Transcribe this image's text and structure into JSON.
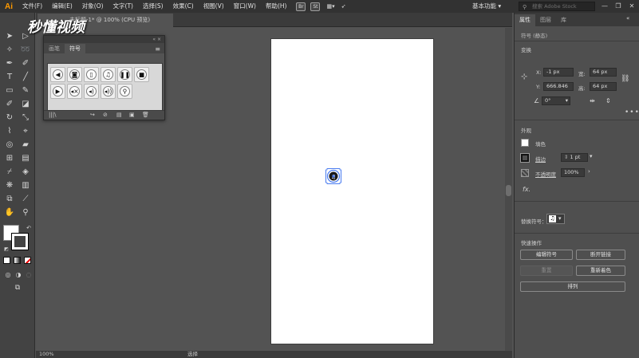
{
  "app": {
    "logo": "Ai"
  },
  "menu": [
    "文件(F)",
    "编辑(E)",
    "对象(O)",
    "文字(T)",
    "选择(S)",
    "效果(C)",
    "视图(V)",
    "窗口(W)",
    "帮助(H)"
  ],
  "menubar": {
    "bridge_label": "Br",
    "stock_label": "St",
    "workspace_label": "基本功能",
    "search_placeholder": "搜索 Adobe Stock",
    "window_buttons": [
      "—",
      "❐",
      "✕"
    ]
  },
  "document_tab": {
    "title": "未标题-1* @ 100% (CPU 预览)",
    "close": "×"
  },
  "watermark": {
    "text": "秒懂视频"
  },
  "symbols_panel": {
    "collapse": "«  ×",
    "tabs": [
      "画笔",
      "符号"
    ],
    "active_tab": "符号",
    "menu_icon": "≡",
    "symbols": [
      {
        "name": "arrow-left-symbol",
        "glyph": "◀"
      },
      {
        "name": "camera-symbol",
        "glyph": "◙"
      },
      {
        "name": "phone-symbol",
        "glyph": "▯"
      },
      {
        "name": "music-note-symbol",
        "glyph": "♫"
      },
      {
        "name": "pause-symbol",
        "glyph": "❚❚"
      },
      {
        "name": "stop-symbol",
        "glyph": "■"
      },
      {
        "name": "play-symbol",
        "glyph": "▶"
      },
      {
        "name": "mute-symbol",
        "glyph": "◂×"
      },
      {
        "name": "volume-low-symbol",
        "glyph": "◂)"
      },
      {
        "name": "volume-high-symbol",
        "glyph": "◂))"
      },
      {
        "name": "search-symbol",
        "glyph": "⚲"
      }
    ],
    "bottom_icons": [
      "|||\\",
      "↪",
      "⊘",
      "▤",
      "▣",
      "🗑"
    ]
  },
  "properties_panel": {
    "tabs": [
      "属性",
      "图层",
      "库"
    ],
    "active_tab": "属性",
    "section_symbol_static": "符号 (静态)",
    "section_transform": "变换",
    "x_label": "X:",
    "x_value": "-1 px",
    "y_label": "Y:",
    "y_value": "666.846",
    "w_label": "宽:",
    "w_value": "64 px",
    "h_label": "高:",
    "h_value": "64 px",
    "angle_value": "0°",
    "section_appearance": "外观",
    "fill_label": "填色",
    "stroke_label": "描边",
    "stroke_weight": "1 pt",
    "opacity_label": "不透明度",
    "opacity_value": "100%",
    "fx_label": "fx.",
    "replace_symbol_label": "替换符号：",
    "section_quick_actions": "快速操作",
    "buttons": {
      "edit_symbol": "编辑符号",
      "break_link": "断开链接",
      "reset": "重置",
      "recolor": "重新着色",
      "arrange": "排列"
    },
    "more": "•••"
  },
  "statusbar": {
    "zoom": "100%",
    "tool": "选择"
  }
}
